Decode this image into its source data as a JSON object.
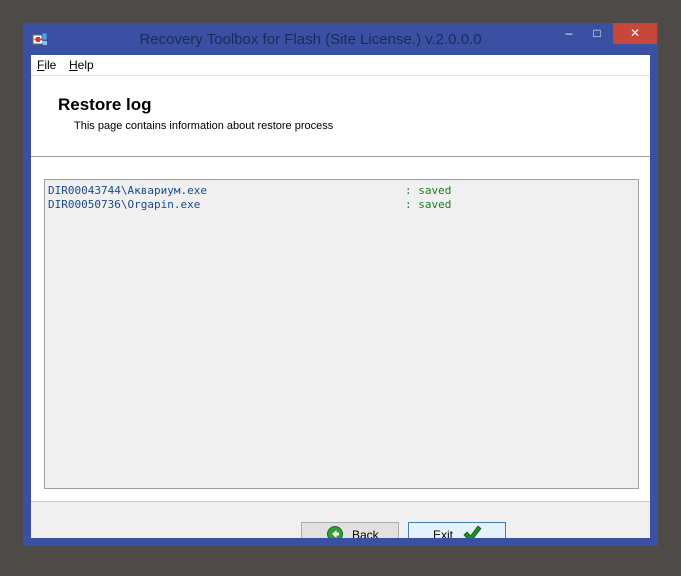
{
  "window": {
    "title": "Recovery Toolbox for Flash (Site License.) v.2.0.0.0",
    "controls": {
      "minimize": "–",
      "maximize": "□",
      "close": "✕"
    }
  },
  "menu": {
    "file": {
      "accel": "F",
      "rest": "ile"
    },
    "help": {
      "accel": "H",
      "rest": "elp"
    }
  },
  "header": {
    "title": "Restore log",
    "subtitle": "This page contains information about restore process"
  },
  "log": {
    "rows": [
      {
        "path": "DIR00043744\\Аквариум.exe",
        "status": ": saved"
      },
      {
        "path": "DIR00050736\\Orgapin.exe",
        "status": ": saved"
      }
    ]
  },
  "buttons": {
    "back": "Back",
    "exit": "Exit"
  },
  "icons": {
    "app": "recovery-toolbox-icon",
    "back": "back-arrow-icon",
    "exit": "checkmark-icon"
  },
  "colors": {
    "window_frame": "#3a51a3",
    "close_button": "#c7473a",
    "log_path": "#1a4a8a",
    "log_status": "#1f7a1f",
    "back_icon": "#2e9e2e",
    "exit_icon": "#1e8c1e"
  }
}
